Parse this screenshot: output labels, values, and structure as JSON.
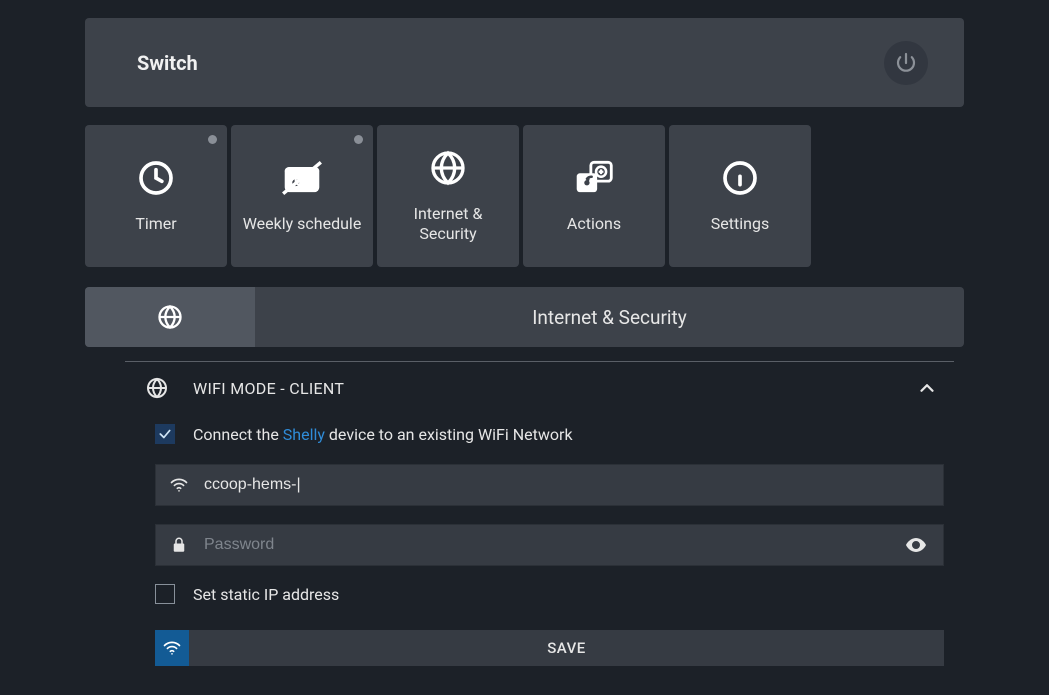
{
  "header": {
    "title": "Switch"
  },
  "tabs": [
    {
      "id": "timer",
      "label": "Timer",
      "dot": true
    },
    {
      "id": "weekly",
      "label": "Weekly schedule",
      "dot": true
    },
    {
      "id": "internet",
      "label": "Internet & Security",
      "dot": false
    },
    {
      "id": "actions",
      "label": "Actions",
      "dot": false
    },
    {
      "id": "settings",
      "label": "Settings",
      "dot": false
    }
  ],
  "section": {
    "title": "Internet & Security"
  },
  "accordion": {
    "label": "WIFI MODE - CLIENT",
    "expanded": true
  },
  "wifi": {
    "connect_checked": true,
    "connect_label_pre": "Connect the ",
    "connect_label_link": "Shelly",
    "connect_label_post": " device to an existing WiFi Network",
    "ssid_value": "ccoop-hems-|",
    "password_value": "",
    "password_placeholder": "Password",
    "static_ip_checked": false,
    "static_ip_label": "Set static IP address",
    "save_label": "SAVE"
  }
}
